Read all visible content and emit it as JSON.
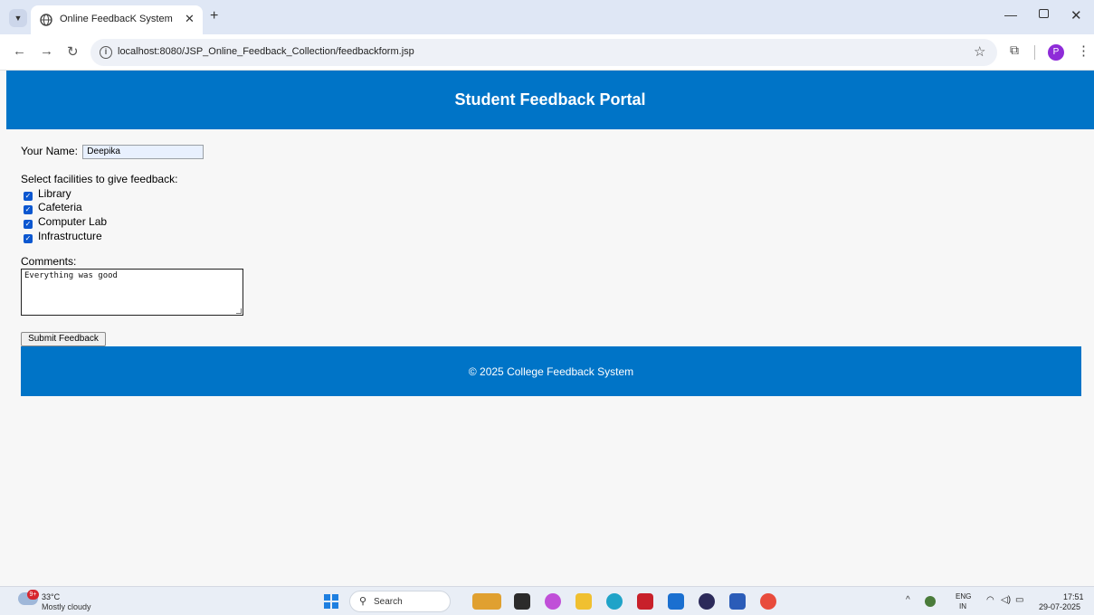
{
  "browser": {
    "tab_title": "Online FeedbacK System",
    "url": "localhost:8080/JSP_Online_Feedback_Collection/feedbackform.jsp",
    "profile_initial": "P"
  },
  "page": {
    "header_title": "Student Feedback Portal",
    "name_label": "Your Name:",
    "name_value": "Deepika",
    "facilities_label": "Select facilities to give feedback:",
    "facilities": [
      {
        "label": "Library",
        "checked": true
      },
      {
        "label": "Cafeteria",
        "checked": true
      },
      {
        "label": "Computer Lab",
        "checked": true
      },
      {
        "label": "Infrastructure",
        "checked": true
      }
    ],
    "comments_label": "Comments:",
    "comments_value": "Everything was good",
    "submit_label": "Submit Feedback",
    "footer_text": "© 2025 College Feedback System",
    "accent_color": "#0074c7"
  },
  "taskbar": {
    "weather_badge": "9+",
    "temperature": "33°C",
    "weather_desc": "Mostly cloudy",
    "search_label": "Search",
    "lang_top": "ENG",
    "lang_bottom": "IN",
    "time": "17:51",
    "date": "29-07-2025",
    "apps": [
      "tiger-widget-icon",
      "task-view-icon",
      "copilot-icon",
      "file-explorer-icon",
      "edge-icon",
      "mcafee-icon",
      "outlook-icon",
      "eclipse-icon",
      "word-icon",
      "chrome-icon"
    ]
  }
}
